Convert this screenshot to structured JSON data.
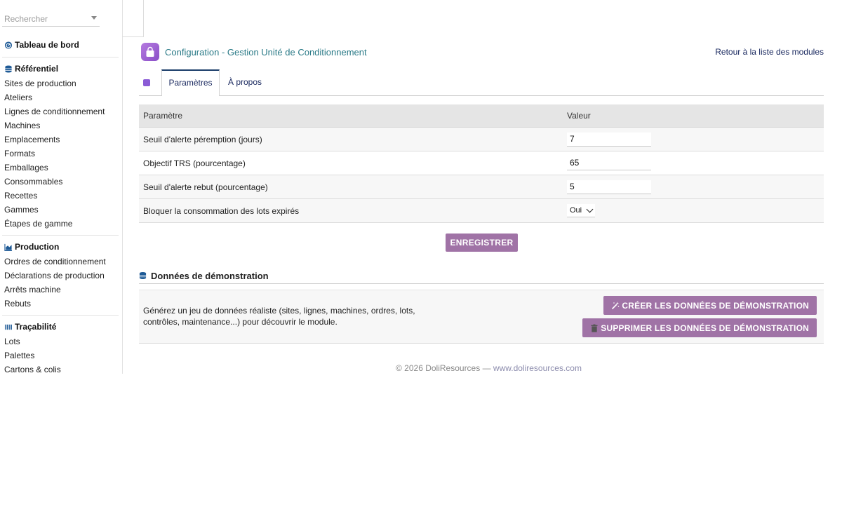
{
  "search": {
    "placeholder": "Rechercher"
  },
  "sidebar": {
    "dashboard": "Tableau de bord",
    "sections": [
      {
        "title": "Référentiel",
        "icon": "database-icon",
        "items": [
          "Sites de production",
          "Ateliers",
          "Lignes de conditionnement",
          "Machines",
          "Emplacements",
          "Formats",
          "Emballages",
          "Consommables",
          "Recettes",
          "Gammes",
          "Étapes de gamme"
        ]
      },
      {
        "title": "Production",
        "icon": "chart-area-icon",
        "items": [
          "Ordres de conditionnement",
          "Déclarations de production",
          "Arrêts machine",
          "Rebuts"
        ]
      },
      {
        "title": "Traçabilité",
        "icon": "barcode-icon",
        "items": [
          "Lots",
          "Palettes",
          "Cartons & colis"
        ]
      }
    ]
  },
  "header": {
    "title": "Configuration - Gestion Unité de Conditionnement",
    "back_link": "Retour à la liste des modules"
  },
  "tabs": [
    {
      "label": "Paramètres",
      "active": true
    },
    {
      "label": "À propos",
      "active": false
    }
  ],
  "table": {
    "col_param": "Paramètre",
    "col_value": "Valeur",
    "rows": [
      {
        "label": "Seuil d'alerte péremption (jours)",
        "value": "7"
      },
      {
        "label": "Objectif TRS (pourcentage)",
        "value": "65"
      },
      {
        "label": "Seuil d'alerte rebut (pourcentage)",
        "value": "5"
      },
      {
        "label": "Bloquer la consommation des lots expirés",
        "value": "Oui"
      }
    ]
  },
  "save_button": "ENREGISTRER",
  "demo": {
    "title": "Données de démonstration",
    "description": "Générez un jeu de données réaliste (sites, lignes, machines, ordres, lots, contrôles, maintenance...) pour découvrir le module.",
    "create_button": "CRÉER LES DONNÉES DE DÉMONSTRATION",
    "delete_button": "SUPPRIMER LES DONNÉES DE DÉMONSTRATION"
  },
  "footer": {
    "copyright": "© 2026 DoliResources — ",
    "link": "www.doliresources.com"
  },
  "colors": {
    "accent_button": "#a073a6",
    "title_teal": "#2a7a87",
    "link_navy": "#1b2a60",
    "app_icon": "#8a4fc8"
  }
}
